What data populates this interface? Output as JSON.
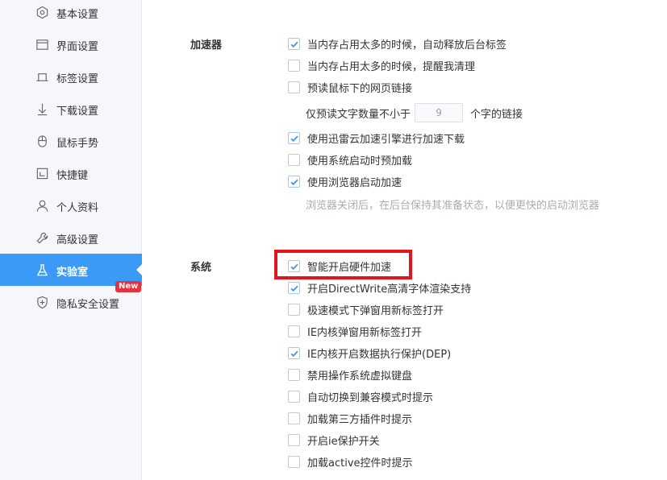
{
  "sidebar": {
    "items": [
      {
        "label": "基本设置"
      },
      {
        "label": "界面设置"
      },
      {
        "label": "标签设置"
      },
      {
        "label": "下载设置"
      },
      {
        "label": "鼠标手势"
      },
      {
        "label": "快捷键"
      },
      {
        "label": "个人资料"
      },
      {
        "label": "高级设置"
      },
      {
        "label": "实验室",
        "active": true
      },
      {
        "label": "隐私安全设置"
      }
    ],
    "new_badge": "New",
    "active_color": "#3c9af7"
  },
  "accelerator": {
    "title": "加速器",
    "options": [
      {
        "label": "当内存占用太多的时候，自动释放后台标签",
        "checked": true
      },
      {
        "label": "当内存占用太多的时候，提醒我清理",
        "checked": false
      },
      {
        "label": "预读鼠标下的网页链接",
        "checked": false
      }
    ],
    "prefetch": {
      "prefix": "仅预读文字数量不小于",
      "value": "9",
      "suffix": "个字的链接"
    },
    "options2": [
      {
        "label": "使用迅雷云加速引擎进行加速下载",
        "checked": true
      },
      {
        "label": "使用系统启动时预加载",
        "checked": false
      },
      {
        "label": "使用浏览器启动加速",
        "checked": true
      }
    ],
    "note": "浏览器关闭后，在后台保持其准备状态，以便更快的启动浏览器"
  },
  "system": {
    "title": "系统",
    "options": [
      {
        "label": "智能开启硬件加速",
        "checked": true
      },
      {
        "label": "开启DirectWrite高清字体渲染支持",
        "checked": true
      },
      {
        "label": "极速模式下弹窗用新标签打开",
        "checked": false
      },
      {
        "label": "IE内核弹窗用新标签打开",
        "checked": false
      },
      {
        "label": "IE内核开启数据执行保护(DEP)",
        "checked": true
      },
      {
        "label": "禁用操作系统虚拟键盘",
        "checked": false
      },
      {
        "label": "自动切换到兼容模式时提示",
        "checked": false
      },
      {
        "label": "加载第三方插件时提示",
        "checked": false
      },
      {
        "label": "开启ie保护开关",
        "checked": false
      },
      {
        "label": "加载active控件时提示",
        "checked": false
      }
    ]
  },
  "colors": {
    "highlight": "#e2151f",
    "check": "#3c9af7",
    "note": "#a8adb3"
  }
}
